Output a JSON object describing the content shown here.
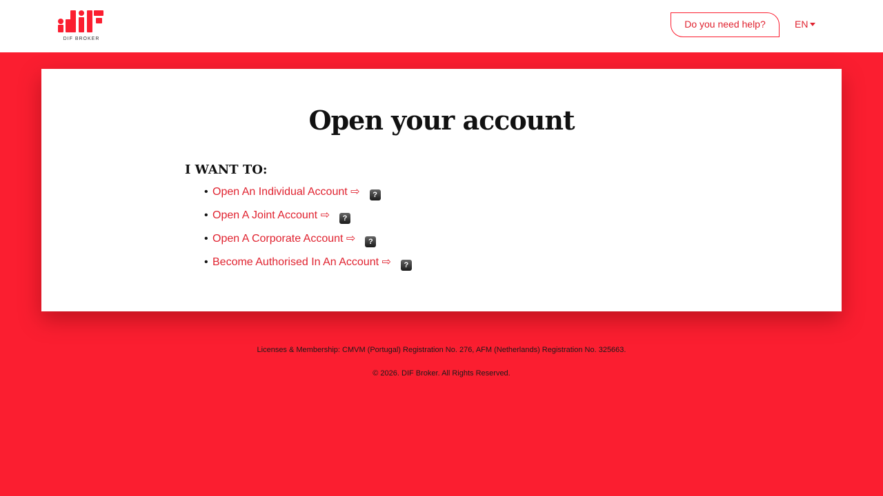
{
  "header": {
    "logo_text": "DIF BROKER",
    "help_label": "Do you need help?",
    "language": "EN"
  },
  "main": {
    "title": "Open your account",
    "subtitle": "I WANT TO:",
    "options": [
      {
        "label": "Open An Individual Account",
        "arrow": "⇨",
        "help_icon": "question-icon"
      },
      {
        "label": "Open A Joint Account",
        "arrow": "⇨",
        "help_icon": "question-icon"
      },
      {
        "label": "Open A Corporate Account",
        "arrow": "⇨",
        "help_icon": "question-icon"
      },
      {
        "label": "Become Authorised In An Account",
        "arrow": "⇨",
        "help_icon": "question-icon"
      }
    ]
  },
  "footer": {
    "licenses": "Licenses & Membership: CMVM (Portugal) Registration No. 276, AFM (Netherlands) Registration No. 325663.",
    "copyright": "© 2026. DIF Broker. All Rights Reserved."
  },
  "colors": {
    "brand_red": "#fb1e30",
    "link_red": "#e0222f"
  }
}
